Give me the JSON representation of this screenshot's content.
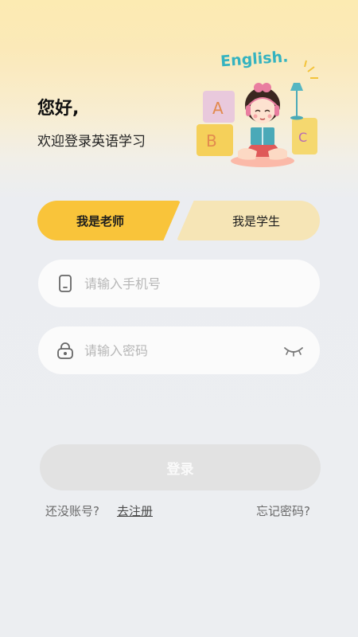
{
  "header": {
    "greeting": "您好,",
    "welcome": "欢迎登录英语学习",
    "illustration_text": "English."
  },
  "tabs": {
    "teacher": "我是老师",
    "student": "我是学生",
    "selected": "teacher"
  },
  "form": {
    "phone_placeholder": "请输入手机号",
    "password_placeholder": "请输入密码",
    "login_label": "登录"
  },
  "footer": {
    "no_account": "还没账号?",
    "register": "去注册",
    "forgot_password": "忘记密码?"
  },
  "colors": {
    "accent": "#f9c43a",
    "tab_inactive": "#f6e5b6",
    "button_disabled": "#e2e2e2"
  }
}
